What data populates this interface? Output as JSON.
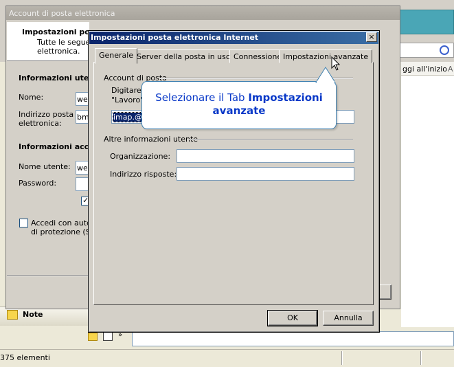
{
  "background": {
    "right_header_text": "ggi all'inizio",
    "right_header_extra": "A",
    "note_label": "Note",
    "status_text": "375 elementi"
  },
  "account_dialog": {
    "title": "Account di posta elettronica",
    "header_title": "Impostazioni pos",
    "header_desc_1": "Tutte le seguer",
    "header_desc_2": "elettronica.",
    "section_user": "Informazioni uten",
    "name_label": "Nome:",
    "name_value": "we",
    "email_label_1": "Indirizzo posta",
    "email_label_2": "elettronica:",
    "email_value": "bm",
    "section_access": "Informazioni acce",
    "username_label": "Nome utente:",
    "username_value": "we",
    "password_label": "Password:",
    "spa_label_1": "Accedi con auten",
    "spa_label_2": "di protezione (SP"
  },
  "dialog": {
    "title": "Impostazioni posta elettronica Internet",
    "close_glyph": "×",
    "tabs": [
      "Generale",
      "Server della posta in uscita",
      "Connessione",
      "Impostazioni avanzate"
    ],
    "account_group": "Account di posta",
    "account_desc_1": "Digitare il",
    "account_desc_2": "\"Lavoro\"",
    "account_value": "imap.@m",
    "other_group": "Altre informazioni utente",
    "org_label": "Organizzazione:",
    "reply_label": "Indirizzo risposte:",
    "ok_label": "OK",
    "cancel_label": "Annulla"
  },
  "callout": {
    "prefix": "Selezionare il Tab ",
    "bold_1": "Impostazioni",
    "bold_2": "avanzate"
  }
}
